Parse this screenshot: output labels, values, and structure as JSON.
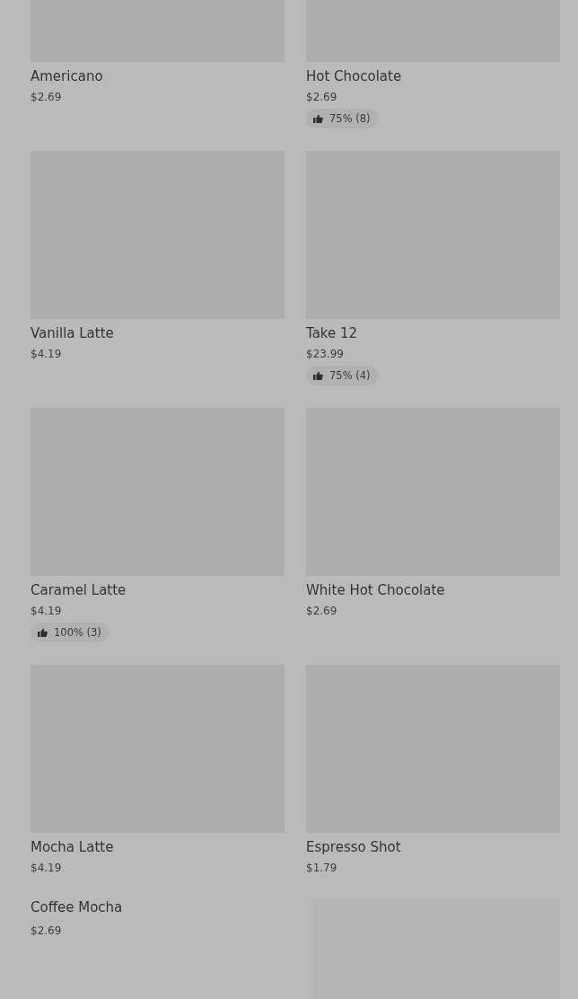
{
  "items": [
    {
      "kind": "product",
      "name": "Americano",
      "price": "$2.69"
    },
    {
      "kind": "product",
      "name": "Hot Chocolate",
      "price": "$2.69",
      "rating": "75% (8)"
    },
    {
      "kind": "product",
      "name": "Vanilla Latte",
      "price": "$4.19"
    },
    {
      "kind": "product",
      "name": "Take 12",
      "price": "$23.99",
      "rating": "75% (4)"
    },
    {
      "kind": "product",
      "name": "Caramel Latte",
      "price": "$4.19",
      "rating": "100% (3)"
    },
    {
      "kind": "product",
      "name": "White Hot Chocolate",
      "price": "$2.69"
    },
    {
      "kind": "product",
      "name": "Mocha Latte",
      "price": "$4.19"
    },
    {
      "kind": "product",
      "name": "Espresso Shot",
      "price": "$1.79"
    },
    {
      "kind": "text",
      "name": "Coffee Mocha",
      "price": "$2.69"
    },
    {
      "kind": "image"
    }
  ]
}
